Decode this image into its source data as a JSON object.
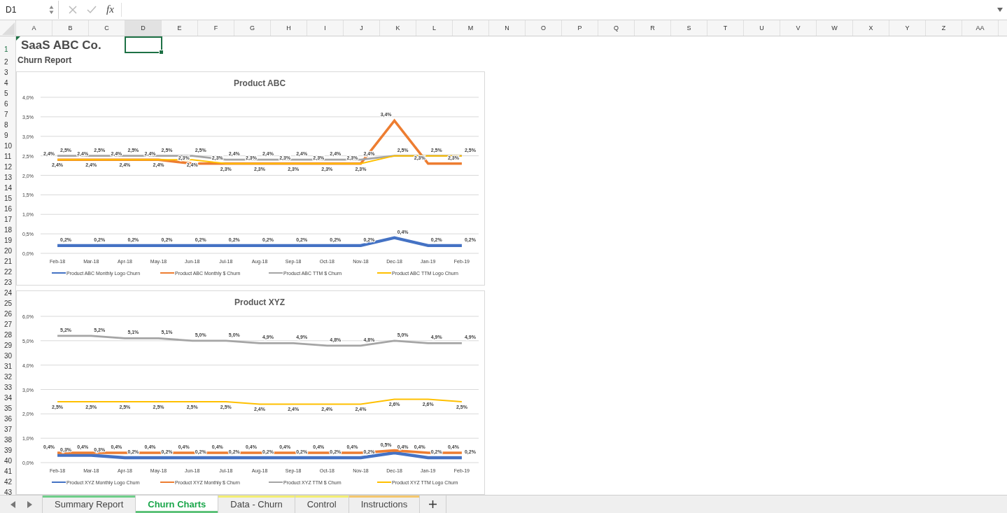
{
  "formula_bar": {
    "name_box": "D1",
    "fx": "fx"
  },
  "columns": [
    {
      "label": "A",
      "selected": false
    },
    {
      "label": "B",
      "selected": false
    },
    {
      "label": "C",
      "selected": false
    },
    {
      "label": "D",
      "selected": true
    },
    {
      "label": "E",
      "selected": false
    },
    {
      "label": "F",
      "selected": false
    },
    {
      "label": "G",
      "selected": false
    },
    {
      "label": "H",
      "selected": false
    },
    {
      "label": "I",
      "selected": false
    },
    {
      "label": "J",
      "selected": false
    },
    {
      "label": "K",
      "selected": false
    },
    {
      "label": "L",
      "selected": false
    },
    {
      "label": "M",
      "selected": false
    },
    {
      "label": "N",
      "selected": false
    },
    {
      "label": "O",
      "selected": false
    },
    {
      "label": "P",
      "selected": false
    },
    {
      "label": "Q",
      "selected": false
    },
    {
      "label": "R",
      "selected": false
    },
    {
      "label": "S",
      "selected": false
    },
    {
      "label": "T",
      "selected": false
    },
    {
      "label": "U",
      "selected": false
    },
    {
      "label": "V",
      "selected": false
    },
    {
      "label": "W",
      "selected": false
    },
    {
      "label": "X",
      "selected": false
    },
    {
      "label": "Y",
      "selected": false
    },
    {
      "label": "Z",
      "selected": false
    },
    {
      "label": "AA",
      "selected": false
    }
  ],
  "rows": [
    {
      "label": "1",
      "selected": true
    },
    {
      "label": "2",
      "selected": false
    },
    {
      "label": "3",
      "selected": false
    },
    {
      "label": "4",
      "selected": false
    },
    {
      "label": "5",
      "selected": false
    },
    {
      "label": "6",
      "selected": false
    },
    {
      "label": "7",
      "selected": false
    },
    {
      "label": "8",
      "selected": false
    },
    {
      "label": "9",
      "selected": false
    },
    {
      "label": "10",
      "selected": false
    },
    {
      "label": "11",
      "selected": false
    },
    {
      "label": "12",
      "selected": false
    },
    {
      "label": "13",
      "selected": false
    },
    {
      "label": "14",
      "selected": false
    },
    {
      "label": "15",
      "selected": false
    },
    {
      "label": "16",
      "selected": false
    },
    {
      "label": "17",
      "selected": false
    },
    {
      "label": "18",
      "selected": false
    },
    {
      "label": "19",
      "selected": false
    },
    {
      "label": "20",
      "selected": false
    },
    {
      "label": "21",
      "selected": false
    },
    {
      "label": "22",
      "selected": false
    },
    {
      "label": "23",
      "selected": false
    },
    {
      "label": "24",
      "selected": false
    },
    {
      "label": "25",
      "selected": false
    },
    {
      "label": "26",
      "selected": false
    },
    {
      "label": "27",
      "selected": false
    },
    {
      "label": "28",
      "selected": false
    },
    {
      "label": "29",
      "selected": false
    },
    {
      "label": "30",
      "selected": false
    },
    {
      "label": "31",
      "selected": false
    },
    {
      "label": "32",
      "selected": false
    },
    {
      "label": "33",
      "selected": false
    },
    {
      "label": "34",
      "selected": false
    },
    {
      "label": "35",
      "selected": false
    },
    {
      "label": "36",
      "selected": false
    },
    {
      "label": "37",
      "selected": false
    },
    {
      "label": "38",
      "selected": false
    },
    {
      "label": "39",
      "selected": false
    },
    {
      "label": "40",
      "selected": false
    },
    {
      "label": "41",
      "selected": false
    },
    {
      "label": "42",
      "selected": false
    },
    {
      "label": "43",
      "selected": false
    }
  ],
  "cells": [
    {
      "text": "SaaS ABC Co.",
      "kind": "title"
    },
    {
      "text": "Churn Report",
      "kind": "subtitle"
    }
  ],
  "charts": [
    {
      "chart_data": {
        "type": "line",
        "title": "Product ABC",
        "grid": true,
        "legend": true,
        "categories": [
          "Feb-18",
          "Mar-18",
          "Apr-18",
          "May-18",
          "Jun-18",
          "Jul-18",
          "Aug-18",
          "Sep-18",
          "Oct-18",
          "Nov-18",
          "Dec-18",
          "Jan-19",
          "Feb-19"
        ],
        "ylim": [
          0,
          4
        ],
        "yticks": [
          {
            "value": 0,
            "label": "0,0%"
          },
          {
            "value": 0.5,
            "label": "0,5%"
          },
          {
            "value": 1,
            "label": "1,0%"
          },
          {
            "value": 1.5,
            "label": "1,5%"
          },
          {
            "value": 2,
            "label": "2,0%"
          },
          {
            "value": 2.5,
            "label": "2,5%"
          },
          {
            "value": 3,
            "label": "3,0%"
          },
          {
            "value": 3.5,
            "label": "3,5%"
          },
          {
            "value": 4,
            "label": "4,0%"
          }
        ],
        "data_labels": true,
        "series": [
          {
            "name": "Product ABC Monthly Logo Churn",
            "color": "#4472c4",
            "values": [
              0.2,
              0.2,
              0.2,
              0.2,
              0.2,
              0.2,
              0.2,
              0.2,
              0.2,
              0.2,
              0.4,
              0.2,
              0.2
            ],
            "value_labels": [
              "0,2%",
              "0,2%",
              "0,2%",
              "0,2%",
              "0,2%",
              "0,2%",
              "0,2%",
              "0,2%",
              "0,2%",
              "0,2%",
              "0,4%",
              "0,2%",
              "0,2%"
            ]
          },
          {
            "name": "Product ABC Monthly $ Churn",
            "color": "#ed7d31",
            "values": [
              2.4,
              2.4,
              2.4,
              2.4,
              2.3,
              2.3,
              2.3,
              2.3,
              2.3,
              2.3,
              3.4,
              2.3,
              2.3
            ],
            "value_labels": [
              "2,4%",
              "2,4%",
              "2,4%",
              "2,4%",
              "2,3%",
              "2,3%",
              "2,3%",
              "2,3%",
              "2,3%",
              "2,3%",
              "3,4%",
              "2,3%",
              "2,3%"
            ]
          },
          {
            "name": "Product ABC TTM $ Churn",
            "color": "#a5a5a5",
            "values": [
              2.5,
              2.5,
              2.5,
              2.5,
              2.5,
              2.4,
              2.4,
              2.4,
              2.4,
              2.4,
              2.5,
              2.5,
              2.5
            ],
            "value_labels": [
              "2,5%",
              "2,5%",
              "2,5%",
              "2,5%",
              "2,5%",
              "2,4%",
              "2,4%",
              "2,4%",
              "2,4%",
              "2,4%",
              "2,5%",
              "2,5%",
              "2,5%"
            ]
          },
          {
            "name": "Product ABC TTM Logo Churn",
            "color": "#ffc000",
            "values": [
              2.4,
              2.4,
              2.4,
              2.4,
              2.4,
              2.3,
              2.3,
              2.3,
              2.3,
              2.3,
              2.5,
              2.5,
              2.5
            ],
            "value_labels": [
              "2,4%",
              "2,4%",
              "2,4%",
              "2,4%",
              "2,4%",
              "2,3%",
              "2,3%",
              "2,3%",
              "2,3%",
              "2,3%",
              null,
              null,
              null
            ]
          }
        ]
      }
    },
    {
      "chart_data": {
        "type": "line",
        "title": "Product XYZ",
        "grid": true,
        "legend": true,
        "categories": [
          "Feb-18",
          "Mar-18",
          "Apr-18",
          "May-18",
          "Jun-18",
          "Jul-18",
          "Aug-18",
          "Sep-18",
          "Oct-18",
          "Nov-18",
          "Dec-18",
          "Jan-19",
          "Feb-19"
        ],
        "ylim": [
          0,
          6
        ],
        "yticks": [
          {
            "value": 0,
            "label": "0,0%"
          },
          {
            "value": 1,
            "label": "1,0%"
          },
          {
            "value": 2,
            "label": "2,0%"
          },
          {
            "value": 3,
            "label": "3,0%"
          },
          {
            "value": 4,
            "label": "4,0%"
          },
          {
            "value": 5,
            "label": "5,0%"
          },
          {
            "value": 6,
            "label": "6,0%"
          }
        ],
        "data_labels": true,
        "series": [
          {
            "name": "Product XYZ Monthly Logo Churn",
            "color": "#4472c4",
            "values": [
              0.3,
              0.3,
              0.2,
              0.2,
              0.2,
              0.2,
              0.2,
              0.2,
              0.2,
              0.2,
              0.4,
              0.2,
              0.2
            ],
            "value_labels": [
              "0,3%",
              "0,3%",
              "0,2%",
              "0,2%",
              "0,2%",
              "0,2%",
              "0,2%",
              "0,2%",
              "0,2%",
              "0,2%",
              "0,4%",
              "0,2%",
              "0,2%"
            ]
          },
          {
            "name": "Product XYZ Monthly $ Churn",
            "color": "#ed7d31",
            "values": [
              0.4,
              0.4,
              0.4,
              0.4,
              0.4,
              0.4,
              0.4,
              0.4,
              0.4,
              0.4,
              0.5,
              0.4,
              0.4
            ],
            "value_labels": [
              "0,4%",
              "0,4%",
              "0,4%",
              "0,4%",
              "0,4%",
              "0,4%",
              "0,4%",
              "0,4%",
              "0,4%",
              "0,4%",
              "0,5%",
              "0,4%",
              "0,4%"
            ]
          },
          {
            "name": "Product XYZ TTM $ Churn",
            "color": "#a5a5a5",
            "values": [
              5.2,
              5.2,
              5.1,
              5.1,
              5.0,
              5.0,
              4.9,
              4.9,
              4.8,
              4.8,
              5.0,
              4.9,
              4.9
            ],
            "value_labels": [
              "5,2%",
              "5,2%",
              "5,1%",
              "5,1%",
              "5,0%",
              "5,0%",
              "4,9%",
              "4,9%",
              "4,8%",
              "4,8%",
              "5,0%",
              "4,9%",
              "4,9%"
            ]
          },
          {
            "name": "Product XYZ TTM Logo Churn",
            "color": "#ffc000",
            "values": [
              2.5,
              2.5,
              2.5,
              2.5,
              2.5,
              2.5,
              2.4,
              2.4,
              2.4,
              2.4,
              2.6,
              2.6,
              2.5
            ],
            "value_labels": [
              "2,5%",
              "2,5%",
              "2,5%",
              "2,5%",
              "2,5%",
              "2,5%",
              "2,4%",
              "2,4%",
              "2,4%",
              "2,4%",
              "2,6%",
              "2,6%",
              "2,5%"
            ]
          }
        ]
      }
    }
  ],
  "sheet_tabs": [
    {
      "label": "Summary Report",
      "selected": false,
      "color": "#6fcf8a"
    },
    {
      "label": "Churn Charts",
      "selected": true,
      "color": "#5ec27a"
    },
    {
      "label": "Data - Churn",
      "selected": false,
      "color": "#f3ee74"
    },
    {
      "label": "Control",
      "selected": false,
      "color": "#f3ee74"
    },
    {
      "label": "Instructions",
      "selected": false,
      "color": "#f4c76e"
    }
  ]
}
